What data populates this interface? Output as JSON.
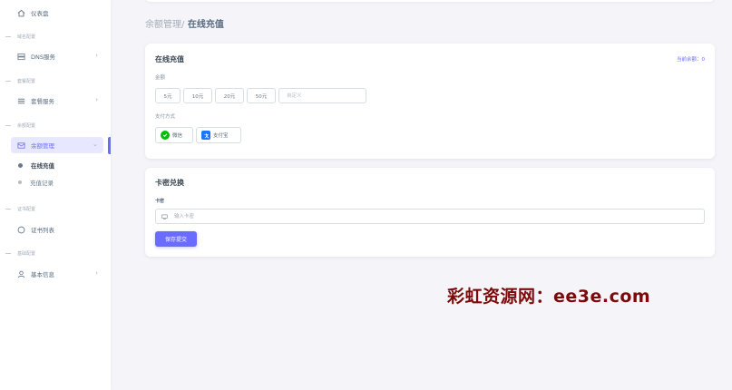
{
  "sidebar": {
    "dashboard": "仪表盘",
    "sections": [
      {
        "header": "域名配置",
        "item": "DNS服务"
      },
      {
        "header": "套餐配置",
        "item": "套餐服务"
      },
      {
        "header": "余额配置",
        "item": "余额管理"
      },
      {
        "header": "证书配置",
        "item": "证书列表"
      },
      {
        "header": "基础配置",
        "item": "基本信息"
      }
    ],
    "sub_items": [
      "在线充值",
      "充值记录"
    ]
  },
  "breadcrumb": {
    "parent": "余额管理/",
    "current": " 在线充值"
  },
  "recharge_card": {
    "title": "在线充值",
    "balance": "当前余额：0",
    "amount_label": "金额",
    "amounts": [
      "5元",
      "10元",
      "20元",
      "50元"
    ],
    "custom_placeholder": "自定义",
    "pay_label": "支付方式",
    "pay_methods": [
      "微信",
      "支付宝"
    ]
  },
  "redeem_card": {
    "title": "卡密兑换",
    "field_label": "卡密",
    "placeholder": "输入卡密",
    "submit": "保存提交"
  },
  "watermark": "彩虹资源网：ee3e.com",
  "colors": {
    "primary": "#696cff",
    "wechat": "#09bb07",
    "alipay": "#1677ff",
    "watermark": "#7d0a0a"
  }
}
